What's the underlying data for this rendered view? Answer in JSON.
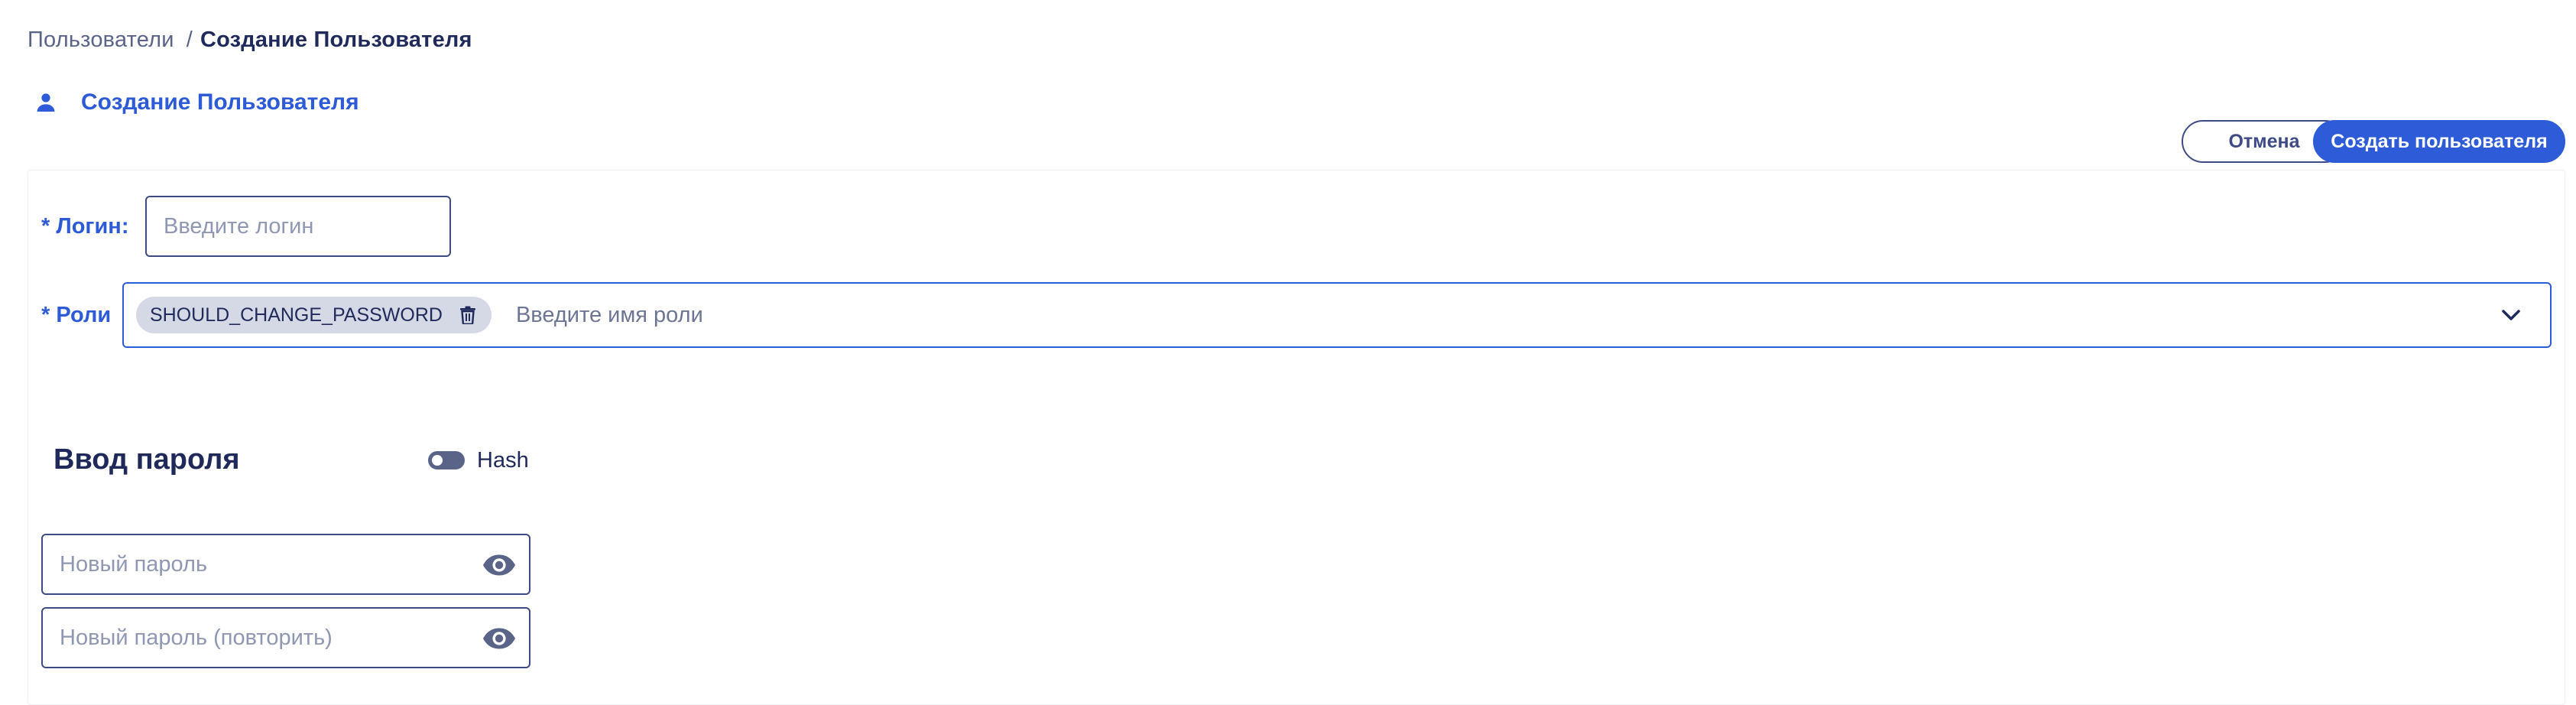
{
  "breadcrumb": {
    "parent": "Пользователи",
    "separator": "/",
    "current": "Создание Пользователя"
  },
  "page": {
    "title": "Создание Пользователя",
    "title_icon": "user-icon"
  },
  "actions": {
    "cancel_label": "Отмена",
    "create_label": "Создать пользователя"
  },
  "form": {
    "login": {
      "label": "* Логин:",
      "placeholder": "Введите логин",
      "value": ""
    },
    "roles": {
      "label": "* Роли",
      "selected": [
        "SHOULD_CHANGE_PASSWORD"
      ],
      "placeholder": "Введите имя роли",
      "chip_remove_icon": "trash-icon",
      "dropdown_icon": "chevron-down-icon"
    },
    "password_section": {
      "title": "Ввод пароля",
      "hash_label": "Hash",
      "hash_enabled": false,
      "new_password_placeholder": "Новый пароль",
      "repeat_password_placeholder": "Новый пароль (повторить)",
      "visibility_icon": "eye-icon"
    }
  },
  "colors": {
    "accent": "#2e5bd8",
    "text_dark": "#1f2a5a",
    "border": "#3e4a86",
    "chip_bg": "#d5d8e5",
    "muted": "#5a6489"
  }
}
